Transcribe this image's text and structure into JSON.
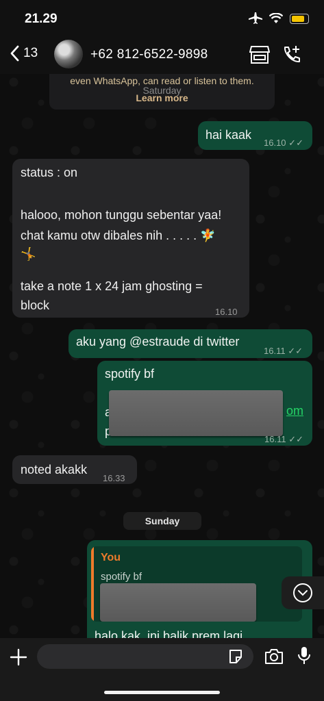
{
  "status_bar": {
    "time": "21.29"
  },
  "header": {
    "back_count": "13",
    "contact_name": "+62 812-6522-9898"
  },
  "encryption_note": {
    "text": "even WhatsApp, can read or listen to them.",
    "link": "Learn more",
    "day": "Saturday"
  },
  "messages": [
    {
      "dir": "out",
      "text": "hai kaak",
      "time": "16.10",
      "read": true
    },
    {
      "dir": "in",
      "lines": [
        "status : on",
        "",
        "halooo, mohon tunggu sebentar yaa!",
        "chat kamu otw dibales nih . . . . . 🧚",
        "🤸",
        "",
        "take a note 1 x 24 jam ghosting =",
        "block"
      ],
      "time": "16.10"
    },
    {
      "dir": "out",
      "text": "aku yang @estraude di twitter",
      "time": "16.11",
      "read": true
    },
    {
      "dir": "out",
      "text": "spotify bf",
      "partial_a": "a",
      "partial_p": "p",
      "partial_link": "om",
      "time": "16.11",
      "read": true
    },
    {
      "dir": "in",
      "text": "noted akakk",
      "time": "16.33"
    }
  ],
  "date_chip": "Sunday",
  "reply": {
    "author": "You",
    "quoted": "spotify bf",
    "text": "halo kak, ini balik prem lagi"
  },
  "colors": {
    "outgoing": "#0f4b36",
    "incoming": "#262628",
    "accent": "#25d366",
    "quote_bar": "#ef7b2b"
  }
}
